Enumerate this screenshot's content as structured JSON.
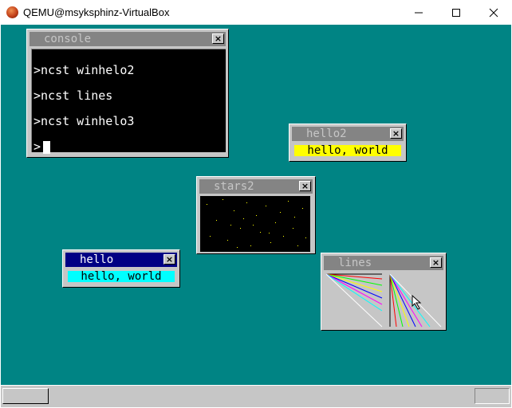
{
  "window": {
    "title": "QEMU@msyksphinz-VirtualBox",
    "minimize_icon": "minimize-icon",
    "maximize_icon": "maximize-icon",
    "close_icon": "close-icon"
  },
  "desktop": {
    "background": "#008484"
  },
  "console": {
    "title": "console",
    "lines": [
      ">ncst winhelo2",
      ">ncst lines",
      ">ncst winhelo3",
      ">"
    ],
    "close": "×"
  },
  "hello2": {
    "title": "hello2",
    "text": "hello, world",
    "bar_color": "#ffff00",
    "close": "×"
  },
  "stars2": {
    "title": "stars2",
    "close": "×"
  },
  "hello": {
    "title": "hello",
    "text": "hello, world",
    "bar_color": "#00ffff",
    "close": "×"
  },
  "lines": {
    "title": "lines",
    "close": "×"
  },
  "cursor_icon": "mouse-pointer-icon"
}
